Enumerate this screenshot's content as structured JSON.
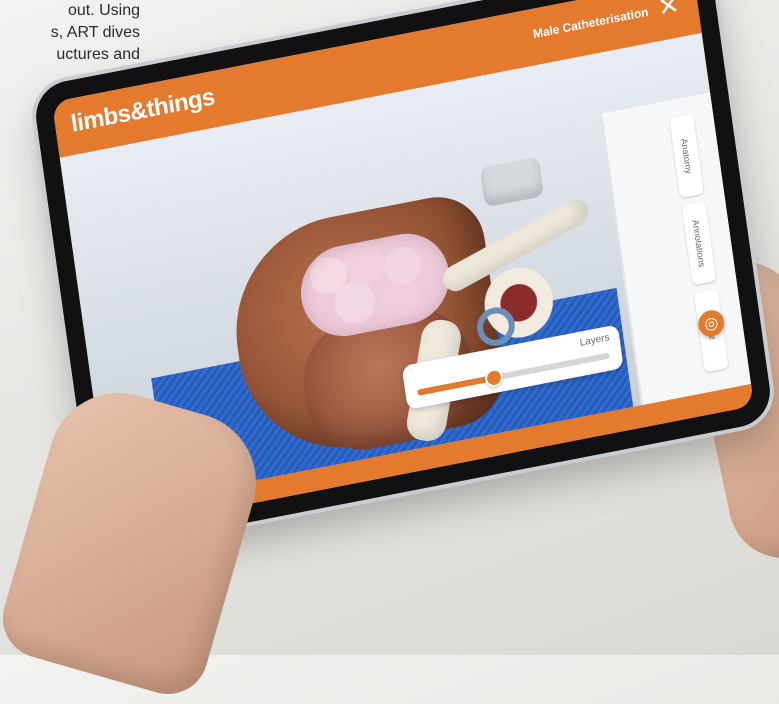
{
  "background_text": {
    "lines": [
      "out. Using",
      "s, ART dives",
      "uctures and"
    ]
  },
  "tablet": {
    "brand": "limbs&things",
    "title": "Male Catheterisation",
    "close_icon": "close-icon",
    "side_tabs": [
      "Anatomy",
      "Annotations",
      "Quiz"
    ],
    "layers": {
      "label": "Layers",
      "value_fraction": 0.4
    },
    "target_icon": "crosshair-icon",
    "colors": {
      "accent": "#e37a2d",
      "floor_blue": "#1f56b8"
    }
  }
}
